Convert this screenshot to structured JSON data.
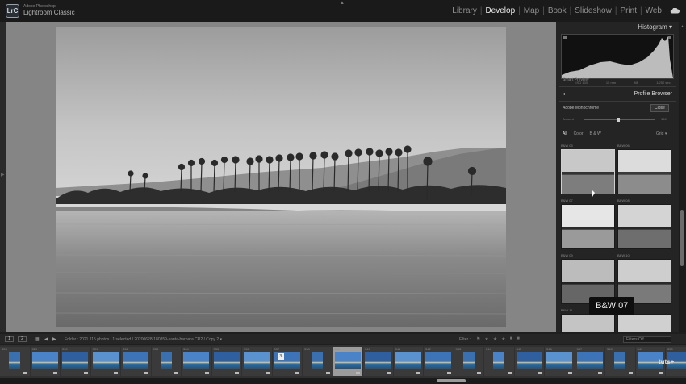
{
  "app": {
    "vendor": "Adobe Photoshop",
    "name": "Lightroom Classic",
    "logo": "LrC"
  },
  "modules": [
    "Library",
    "Develop",
    "Map",
    "Book",
    "Slideshow",
    "Print",
    "Web"
  ],
  "active_module": "Develop",
  "right_panel": {
    "histogram_title": "Histogram",
    "histogram_info": [
      "ISO 100",
      "15 mm",
      "f/8",
      "1/250 sec"
    ],
    "smart_preview": "Smart Preview",
    "profile_browser_title": "Profile Browser",
    "profile_name": "Adobe Monochrome",
    "close_label": "Close",
    "amount_label": "Amount",
    "amount_value": "100",
    "filters": [
      "All",
      "Color",
      "B & W"
    ],
    "view_mode": "Grid",
    "thumbnails": [
      {
        "label": "B&W 05"
      },
      {
        "label": "B&W 06"
      },
      {
        "label": "B&W 07"
      },
      {
        "label": "B&W 08"
      },
      {
        "label": "B&W 09"
      },
      {
        "label": "B&W 10"
      },
      {
        "label": "B&W 11"
      },
      {
        "label": "B&W 12"
      }
    ],
    "tooltip": "B&W 07"
  },
  "filmstrip_toolbar": {
    "page1": "1",
    "page2": "2",
    "path": "Folder : 2021    115 photos / 1 selected / 20200628-180859-santa-barbara.CR2 / Copy 2 ▾",
    "filter_label": "Filter :",
    "filter_value": "Filters Off"
  },
  "filmstrip": {
    "selected_index": 11,
    "frame_numbers": [
      "328",
      "329",
      "330",
      "331",
      "332",
      "333",
      "334",
      "335",
      "336",
      "337",
      "338",
      "339",
      "340",
      "341",
      "342",
      "343",
      "344",
      "345",
      "346",
      "347",
      "348",
      "349",
      "350"
    ],
    "count_badge": "3"
  },
  "watermark": "tuts+",
  "colors": {
    "panel_bg": "#242424",
    "canvas_bg": "#858585",
    "active_module": "#efefef"
  }
}
